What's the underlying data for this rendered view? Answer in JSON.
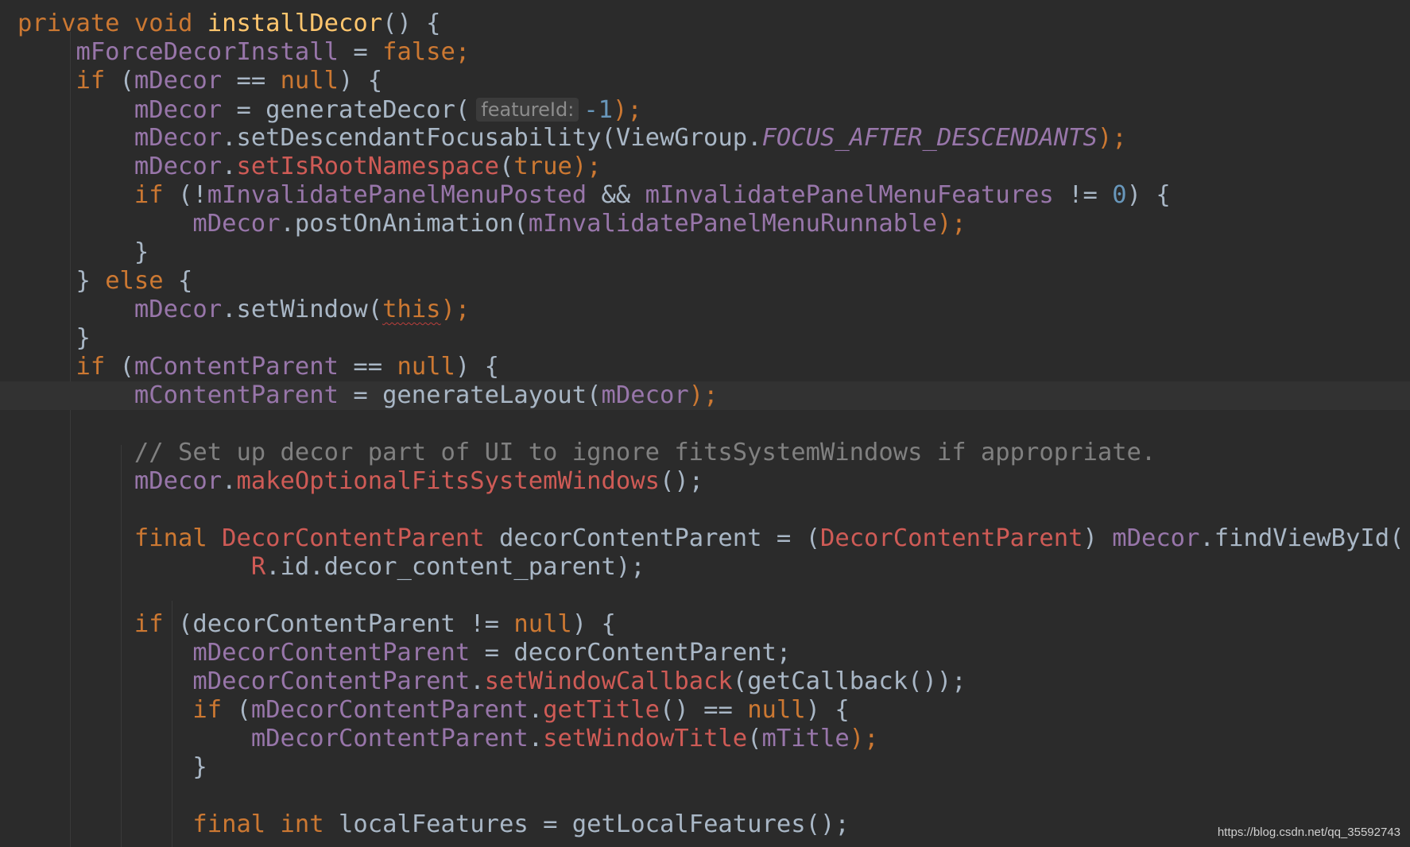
{
  "editor": {
    "watermark": "https://blog.csdn.net/qq_35592743",
    "colors": {
      "background": "#2b2b2b",
      "keyword": "#cc7832",
      "method_decl": "#ffc66d",
      "field": "#9876aa",
      "number": "#6897bb",
      "unresolved": "#cf5b56",
      "comment": "#808080",
      "text": "#a9b7c6"
    },
    "current_line": 14,
    "lines": [
      [
        {
          "t": "private void ",
          "c": "kw"
        },
        {
          "t": "installDecor",
          "c": "fn"
        },
        {
          "t": "() {",
          "c": "plain"
        }
      ],
      [
        {
          "t": "    ",
          "c": "plain"
        },
        {
          "t": "mForceDecorInstall",
          "c": "fld"
        },
        {
          "t": " = ",
          "c": "plain"
        },
        {
          "t": "false;",
          "c": "kw"
        }
      ],
      [
        {
          "t": "    ",
          "c": "plain"
        },
        {
          "t": "if ",
          "c": "kw"
        },
        {
          "t": "(",
          "c": "plain"
        },
        {
          "t": "mDecor",
          "c": "fld"
        },
        {
          "t": " == ",
          "c": "plain"
        },
        {
          "t": "null",
          "c": "kw"
        },
        {
          "t": ") {",
          "c": "plain"
        }
      ],
      [
        {
          "t": "        ",
          "c": "plain"
        },
        {
          "t": "mDecor",
          "c": "fld"
        },
        {
          "t": " = generateDecor(",
          "c": "plain"
        },
        {
          "t": "featureId:",
          "c": "hint"
        },
        {
          "t": "-1",
          "c": "num"
        },
        {
          "t": ");",
          "c": "kw"
        }
      ],
      [
        {
          "t": "        ",
          "c": "plain"
        },
        {
          "t": "mDecor",
          "c": "fld"
        },
        {
          "t": ".setDescendantFocusability(ViewGroup.",
          "c": "plain"
        },
        {
          "t": "FOCUS_AFTER_DESCENDANTS",
          "c": "cst"
        },
        {
          "t": ");",
          "c": "kw"
        }
      ],
      [
        {
          "t": "        ",
          "c": "plain"
        },
        {
          "t": "mDecor",
          "c": "fld"
        },
        {
          "t": ".",
          "c": "plain"
        },
        {
          "t": "setIsRootNamespace",
          "c": "red"
        },
        {
          "t": "(",
          "c": "plain"
        },
        {
          "t": "true",
          "c": "kw"
        },
        {
          "t": ");",
          "c": "kw"
        }
      ],
      [
        {
          "t": "        ",
          "c": "plain"
        },
        {
          "t": "if ",
          "c": "kw"
        },
        {
          "t": "(!",
          "c": "plain"
        },
        {
          "t": "mInvalidatePanelMenuPosted",
          "c": "fld"
        },
        {
          "t": " && ",
          "c": "plain"
        },
        {
          "t": "mInvalidatePanelMenuFeatures",
          "c": "fld"
        },
        {
          "t": " != ",
          "c": "plain"
        },
        {
          "t": "0",
          "c": "num"
        },
        {
          "t": ") {",
          "c": "plain"
        }
      ],
      [
        {
          "t": "            ",
          "c": "plain"
        },
        {
          "t": "mDecor",
          "c": "fld"
        },
        {
          "t": ".postOnAnimation(",
          "c": "plain"
        },
        {
          "t": "mInvalidatePanelMenuRunnable",
          "c": "fld"
        },
        {
          "t": ");",
          "c": "kw"
        }
      ],
      [
        {
          "t": "        }",
          "c": "plain"
        }
      ],
      [
        {
          "t": "    } ",
          "c": "plain"
        },
        {
          "t": "else",
          "c": "kw"
        },
        {
          "t": " {",
          "c": "plain"
        }
      ],
      [
        {
          "t": "        ",
          "c": "plain"
        },
        {
          "t": "mDecor",
          "c": "fld"
        },
        {
          "t": ".setWindow(",
          "c": "plain"
        },
        {
          "t": "this",
          "c": "kw squiggle"
        },
        {
          "t": ");",
          "c": "kw"
        }
      ],
      [
        {
          "t": "    }",
          "c": "plain"
        }
      ],
      [
        {
          "t": "    ",
          "c": "plain"
        },
        {
          "t": "if ",
          "c": "kw"
        },
        {
          "t": "(",
          "c": "plain"
        },
        {
          "t": "mContentParent",
          "c": "fld"
        },
        {
          "t": " == ",
          "c": "plain"
        },
        {
          "t": "null",
          "c": "kw"
        },
        {
          "t": ") {",
          "c": "plain"
        }
      ],
      [
        {
          "t": "        ",
          "c": "plain"
        },
        {
          "t": "mContentParent",
          "c": "fld"
        },
        {
          "t": " = generateLayout(",
          "c": "plain"
        },
        {
          "t": "mDecor",
          "c": "fld"
        },
        {
          "t": ");",
          "c": "kw"
        }
      ],
      [],
      [
        {
          "t": "        // Set up decor part of UI to ignore fitsSystemWindows if appropriate.",
          "c": "cmt"
        }
      ],
      [
        {
          "t": "        ",
          "c": "plain"
        },
        {
          "t": "mDecor",
          "c": "fld"
        },
        {
          "t": ".",
          "c": "plain"
        },
        {
          "t": "makeOptionalFitsSystemWindows",
          "c": "red"
        },
        {
          "t": "();",
          "c": "plain"
        }
      ],
      [],
      [
        {
          "t": "        ",
          "c": "plain"
        },
        {
          "t": "final ",
          "c": "kw"
        },
        {
          "t": "DecorContentParent",
          "c": "red"
        },
        {
          "t": " decorContentParent = (",
          "c": "plain"
        },
        {
          "t": "DecorContentParent",
          "c": "red"
        },
        {
          "t": ") ",
          "c": "plain"
        },
        {
          "t": "mDecor",
          "c": "fld"
        },
        {
          "t": ".findViewById(",
          "c": "plain"
        }
      ],
      [
        {
          "t": "                ",
          "c": "plain"
        },
        {
          "t": "R",
          "c": "red"
        },
        {
          "t": ".id.decor_content_parent);",
          "c": "plain"
        }
      ],
      [],
      [
        {
          "t": "        ",
          "c": "plain"
        },
        {
          "t": "if ",
          "c": "kw"
        },
        {
          "t": "(decorContentParent != ",
          "c": "plain"
        },
        {
          "t": "null",
          "c": "kw"
        },
        {
          "t": ") {",
          "c": "plain"
        }
      ],
      [
        {
          "t": "            ",
          "c": "plain"
        },
        {
          "t": "mDecorContentParent",
          "c": "fld"
        },
        {
          "t": " = decorContentParent;",
          "c": "plain"
        }
      ],
      [
        {
          "t": "            ",
          "c": "plain"
        },
        {
          "t": "mDecorContentParent",
          "c": "fld"
        },
        {
          "t": ".",
          "c": "plain"
        },
        {
          "t": "setWindowCallback",
          "c": "red"
        },
        {
          "t": "(getCallback());",
          "c": "plain"
        }
      ],
      [
        {
          "t": "            ",
          "c": "plain"
        },
        {
          "t": "if ",
          "c": "kw"
        },
        {
          "t": "(",
          "c": "plain"
        },
        {
          "t": "mDecorContentParent",
          "c": "fld"
        },
        {
          "t": ".",
          "c": "plain"
        },
        {
          "t": "getTitle",
          "c": "red"
        },
        {
          "t": "() == ",
          "c": "plain"
        },
        {
          "t": "null",
          "c": "kw"
        },
        {
          "t": ") {",
          "c": "plain"
        }
      ],
      [
        {
          "t": "                ",
          "c": "plain"
        },
        {
          "t": "mDecorContentParent",
          "c": "fld"
        },
        {
          "t": ".",
          "c": "plain"
        },
        {
          "t": "setWindowTitle",
          "c": "red"
        },
        {
          "t": "(",
          "c": "plain"
        },
        {
          "t": "mTitle",
          "c": "fld"
        },
        {
          "t": ");",
          "c": "kw"
        }
      ],
      [
        {
          "t": "            }",
          "c": "plain"
        }
      ],
      [],
      [
        {
          "t": "            ",
          "c": "plain"
        },
        {
          "t": "final ",
          "c": "kw"
        },
        {
          "t": "int ",
          "c": "kw"
        },
        {
          "t": "localFeatures = getLocalFeatures();",
          "c": "plain"
        }
      ]
    ]
  }
}
